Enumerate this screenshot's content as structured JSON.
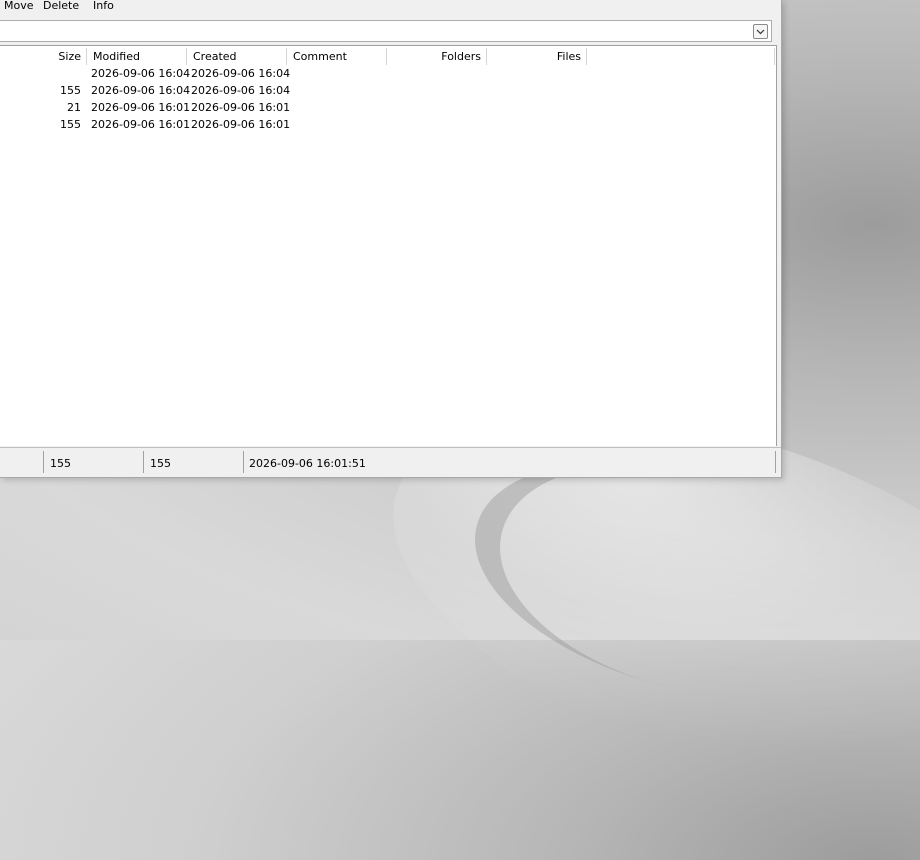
{
  "menu": {
    "move": "Move",
    "delete": "Delete",
    "info": "Info"
  },
  "columns": [
    {
      "label": "Size"
    },
    {
      "label": "Modified"
    },
    {
      "label": "Created"
    },
    {
      "label": "Comment"
    },
    {
      "label": "Folders"
    },
    {
      "label": "Files"
    }
  ],
  "rows": [
    {
      "size": "",
      "modified": "2026-09-06 16:04",
      "created": "2026-09-06 16:04"
    },
    {
      "size": "155",
      "modified": "2026-09-06 16:04",
      "created": "2026-09-06 16:04"
    },
    {
      "size": "21",
      "modified": "2026-09-06 16:01",
      "created": "2026-09-06 16:01"
    },
    {
      "size": "155",
      "modified": "2026-09-06 16:01",
      "created": "2026-09-06 16:01"
    }
  ],
  "status": {
    "size": "155",
    "size2": "155",
    "datetime": "2026-09-06 16:01:51"
  },
  "icons": {
    "combo_dropdown": "chevron-down-icon"
  }
}
